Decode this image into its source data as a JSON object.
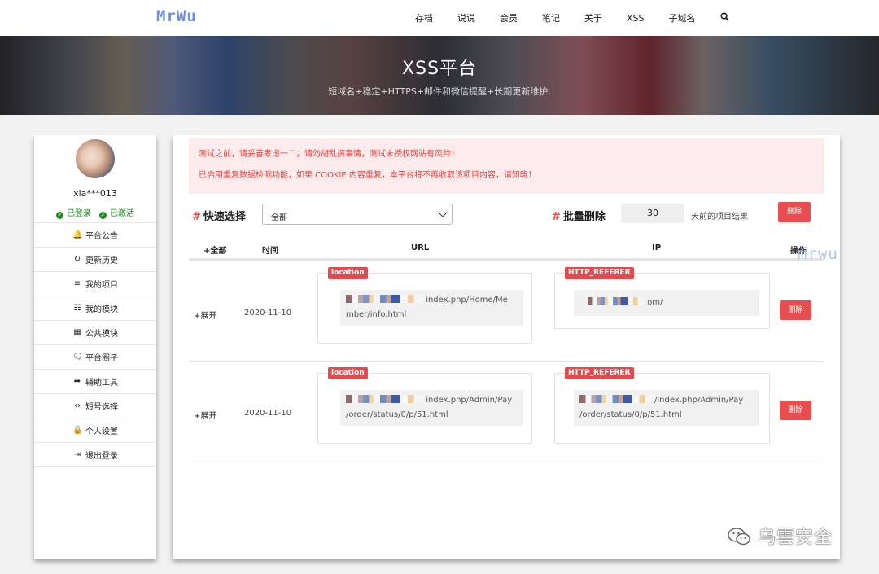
{
  "nav": {
    "logo": "MrWu",
    "items": [
      "存档",
      "说说",
      "会员",
      "笔记",
      "关于",
      "XSS",
      "子域名"
    ],
    "search_icon": "search-icon"
  },
  "banner": {
    "title": "XSS平台",
    "subtitle": "短域名+稳定+HTTPS+邮件和微信提醒+长期更新维护."
  },
  "sidebar": {
    "username": "xia***013",
    "status": [
      "已登录",
      "已激活"
    ],
    "status_color": "#1e8f1e",
    "items": [
      {
        "label": "平台公告",
        "icon": "bell-icon",
        "glyph": "🔔"
      },
      {
        "label": "更新历史",
        "icon": "refresh-icon",
        "glyph": "↻"
      },
      {
        "label": "我的项目",
        "icon": "list-icon",
        "glyph": "≡"
      },
      {
        "label": "我的模块",
        "icon": "list-ul-icon",
        "glyph": "☷"
      },
      {
        "label": "公共模块",
        "icon": "grid-icon",
        "glyph": "▦"
      },
      {
        "label": "平台圈子",
        "icon": "comments-icon",
        "glyph": "🗨"
      },
      {
        "label": "辅助工具",
        "icon": "share-arrow-icon",
        "glyph": "➦"
      },
      {
        "label": "短号选择",
        "icon": "code-icon",
        "glyph": "‹›"
      },
      {
        "label": "个人设置",
        "icon": "user-lock-icon",
        "glyph": "🔒"
      },
      {
        "label": "退出登录",
        "icon": "sign-out-icon",
        "glyph": "⇥"
      }
    ]
  },
  "alert": {
    "line1": "测试之前，请妥善考虑一二，请勿胡乱搞事情，测试未授权网站有风险！",
    "line2": "已启用重复数据检测功能，如果 COOKIE 内容重复，本平台将不再收取该项目内容，请知晓！",
    "color": "#e8413c"
  },
  "controls": {
    "quick_select_label": "快速选择",
    "quick_select_value": "全部",
    "batch_delete_label": "批量删除",
    "days_value": "30",
    "days_suffix": "天前的项目结果",
    "delete_label": "删除"
  },
  "table": {
    "headers": [
      "+全部",
      "时间",
      "URL",
      "IP",
      "操作"
    ],
    "watermark": "mrwu",
    "rows": [
      {
        "expand": "+展开",
        "date": "2020-11-10",
        "url_tag": "location",
        "url_line1": "index.php/Home/Me",
        "url_line2": "mber/info.html",
        "ip_tag": "HTTP_REFERER",
        "ip_line1": "om/",
        "ip_line2": "",
        "delete": "删除"
      },
      {
        "expand": "+展开",
        "date": "2020-11-10",
        "url_tag": "location",
        "url_line1": "index.php/Admin/Pay",
        "url_line2": "/order/status/0/p/51.html",
        "ip_tag": "HTTP_REFERER",
        "ip_line1": "/index.php/Admin/Pay",
        "ip_line2": "/order/status/0/p/51.html",
        "delete": "删除"
      }
    ]
  },
  "footer_watermark": "乌雲安全",
  "accent_red": "#e84d4f"
}
